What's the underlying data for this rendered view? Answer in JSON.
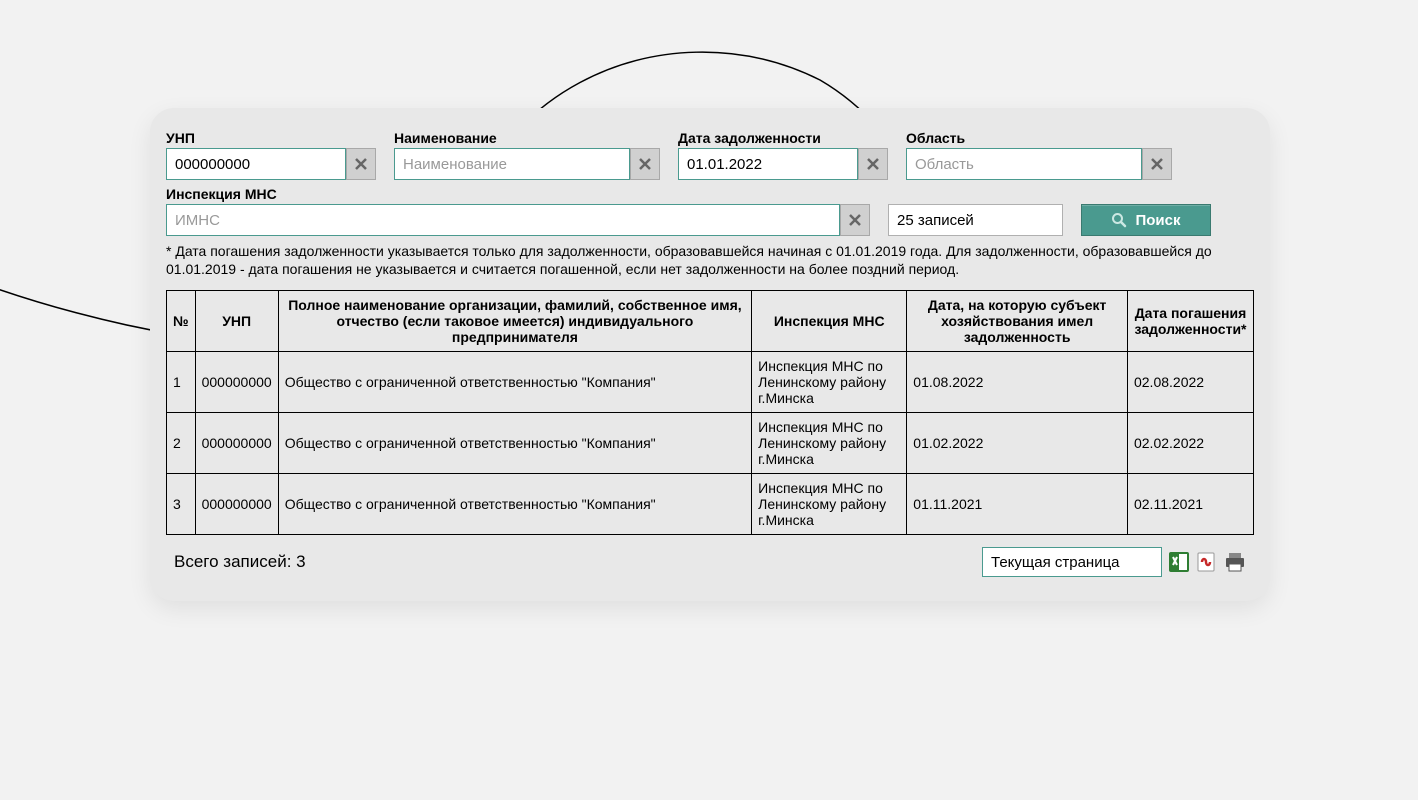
{
  "filters": {
    "unp": {
      "label": "УНП",
      "value": "000000000"
    },
    "name": {
      "label": "Наименование",
      "placeholder": "Наименование",
      "value": ""
    },
    "debt_date": {
      "label": "Дата задолженности",
      "value": "01.01.2022"
    },
    "region": {
      "label": "Область",
      "placeholder": "Область",
      "value": ""
    },
    "inspection": {
      "label": "Инспекция МНС",
      "placeholder": "ИМНС",
      "value": ""
    },
    "records": {
      "value": "25 записей"
    },
    "search_label": "Поиск"
  },
  "footnote": "* Дата погашения задолженности указывается только для задолженности, образовавшейся начиная с 01.01.2019 года. Для задолженности, образовавшейся до 01.01.2019 - дата погашения не указывается и считается погашенной, если нет задолженности на более поздний период.",
  "table": {
    "headers": {
      "num": "№",
      "unp": "УНП",
      "full_name": "Полное наименование организации, фамилий, собственное имя, отчество (если таковое имеется) индивидуального предпринимателя",
      "inspection": "Инспекция МНС",
      "debt_date": "Дата, на которую субъект хозяйствования имел задолженность",
      "repay_date": "Дата погашения задолженности*"
    },
    "rows": [
      {
        "num": "1",
        "unp": "000000000",
        "full_name": "Общество с ограниченной ответственностью \"Компания\"",
        "inspection": "Инспекция МНС по Ленинскому району г.Минска",
        "debt_date": "01.08.2022",
        "repay_date": "02.08.2022"
      },
      {
        "num": "2",
        "unp": "000000000",
        "full_name": "Общество с ограниченной ответственностью \"Компания\"",
        "inspection": "Инспекция МНС по Ленинскому району г.Минска",
        "debt_date": "01.02.2022",
        "repay_date": "02.02.2022"
      },
      {
        "num": "3",
        "unp": "000000000",
        "full_name": "Общество с ограниченной ответственностью \"Компания\"",
        "inspection": "Инспекция МНС по Ленинскому району г.Минска",
        "debt_date": "01.11.2021",
        "repay_date": "02.11.2021"
      }
    ]
  },
  "footer": {
    "total": "Всего записей: 3",
    "page_select": "Текущая страница"
  }
}
